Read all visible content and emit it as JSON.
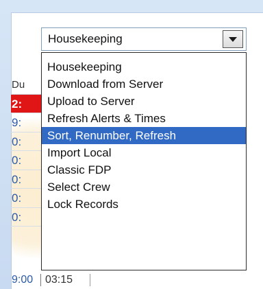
{
  "combo": {
    "value": "Housekeeping",
    "button_icon": "chevron-down-icon"
  },
  "dropdown": {
    "items": [
      {
        "label": "Housekeeping",
        "selected": false
      },
      {
        "label": "Download from Server",
        "selected": false
      },
      {
        "label": "Upload to Server",
        "selected": false
      },
      {
        "label": "Refresh Alerts & Times",
        "selected": false
      },
      {
        "label": "Sort, Renumber, Refresh",
        "selected": true
      },
      {
        "label": "Import Local",
        "selected": false
      },
      {
        "label": "Classic FDP",
        "selected": false
      },
      {
        "label": "Select Crew",
        "selected": false
      },
      {
        "label": "Lock Records",
        "selected": false
      }
    ]
  },
  "time_column": {
    "header": "Du",
    "cells": [
      "2:",
      "9:",
      "0:",
      "0:",
      "0:",
      "0:",
      "0:"
    ]
  },
  "bottom_row": {
    "time1": "9:00",
    "time2": "03:15"
  },
  "colors": {
    "selection": "#316ac5",
    "alert_red": "#e01616",
    "time_blue": "#2b5aa8"
  }
}
